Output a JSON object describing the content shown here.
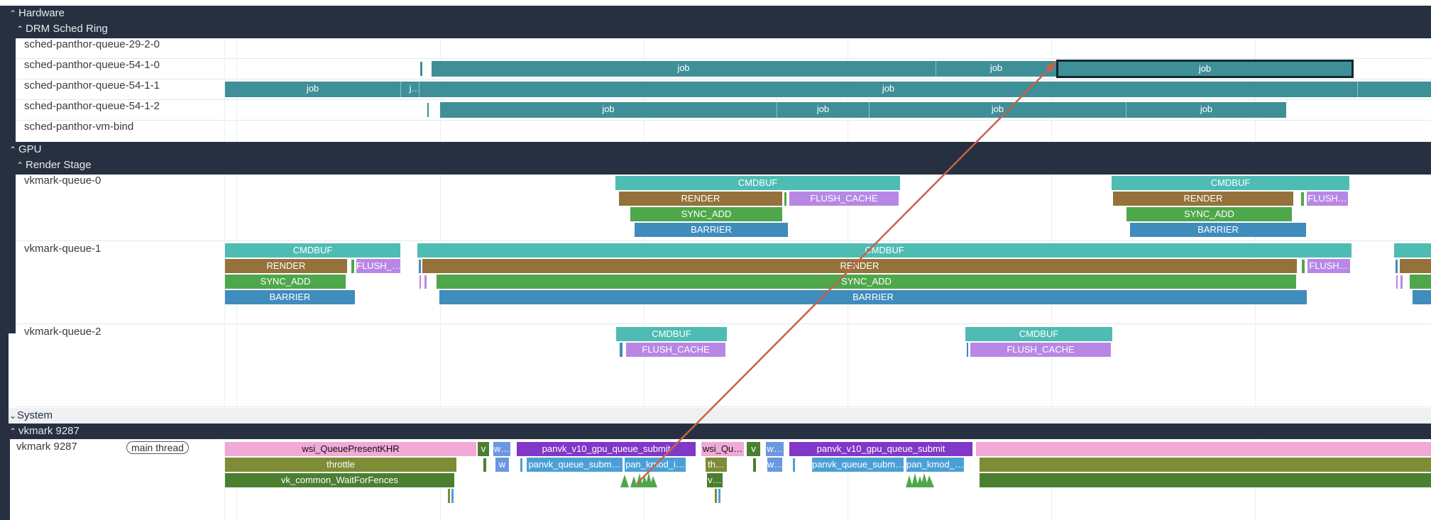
{
  "sections": {
    "hardware": "Hardware",
    "drm": "DRM Sched Ring",
    "gpu": "GPU",
    "render_stage": "Render Stage",
    "system": "System",
    "vkmark_group": "vkmark 9287"
  },
  "drm_tracks": [
    "sched-panthor-queue-29-2-0",
    "sched-panthor-queue-54-1-0",
    "sched-panthor-queue-54-1-1",
    "sched-panthor-queue-54-1-2",
    "sched-panthor-vm-bind"
  ],
  "gpu_tracks": [
    "vkmark-queue-0",
    "vkmark-queue-1",
    "vkmark-queue-2"
  ],
  "thread": {
    "name": "vkmark 9287",
    "tag": "main thread"
  },
  "slices": {
    "job": "job",
    "job_short": "j…",
    "cmdbuf": "CMDBUF",
    "render": "RENDER",
    "flush_cache": "FLUSH_CACHE",
    "flush_short": "FLUSH…",
    "flush_short2": "FLUSH_…",
    "sync_add": "SYNC_ADD",
    "barrier": "BARRIER",
    "wsi_present": "wsi_QueuePresentKHR",
    "throttle": "throttle",
    "wait_fences": "vk_common_WaitForFences",
    "v": "v",
    "w_dots": "w…",
    "w": "w",
    "submit": "panvk_v10_gpu_queue_submit",
    "queue_subm": "panvk_queue_subm…",
    "kmod_i": "pan_kmod_i…",
    "wsi_qu": "wsi_Qu…",
    "th": "th…",
    "v_dots": "v…",
    "kmod": "pan_kmod_…"
  },
  "colors": {
    "header_bg": "#263040",
    "job": "#3f8f98",
    "cmdbuf": "#4fbcb4",
    "render": "#95723c",
    "flush_cache": "#b887e5",
    "sync_add": "#4fa74b",
    "barrier": "#3f8cbd",
    "flow_arrow": "#c8614a"
  }
}
